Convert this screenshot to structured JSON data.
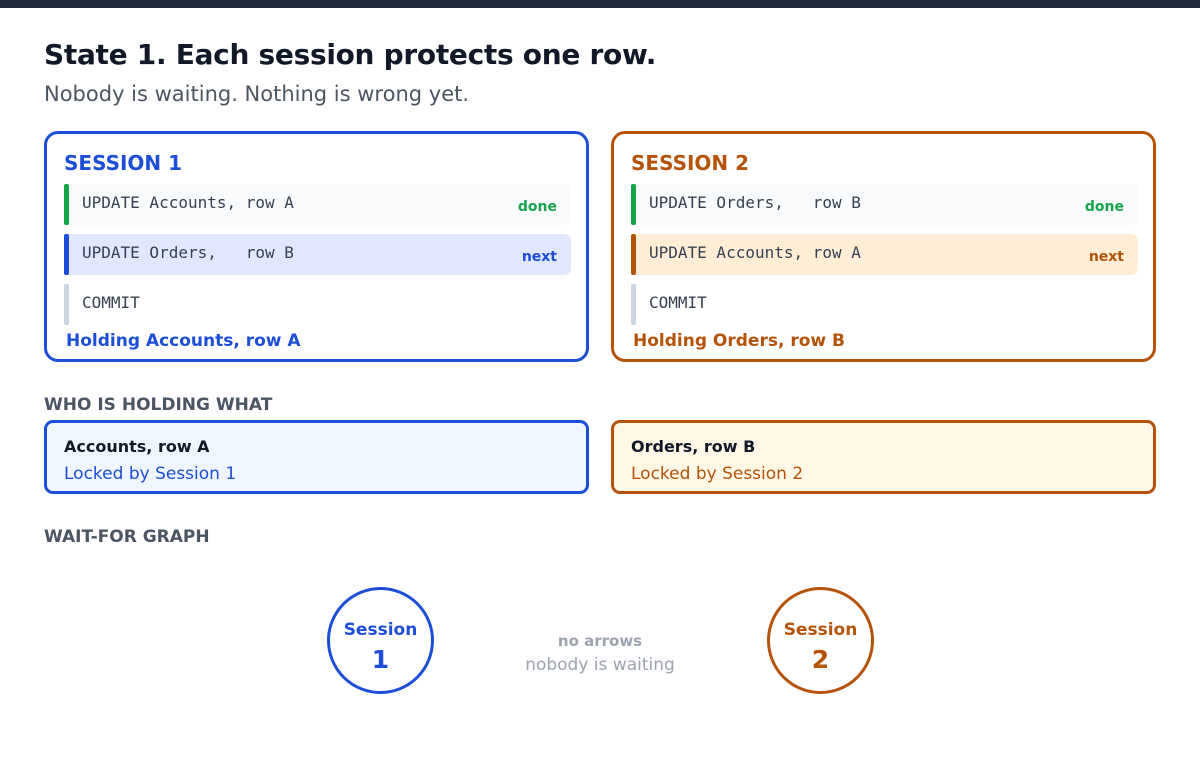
{
  "header": {
    "title": "State 1. Each session protects one row.",
    "subtitle": "Nobody is waiting. Nothing is wrong yet."
  },
  "sessions": [
    {
      "title": "SESSION 1",
      "statements": [
        {
          "sql": "UPDATE Accounts, row A",
          "status": "done"
        },
        {
          "sql": "UPDATE Orders,   row B",
          "status": "next"
        },
        {
          "sql": "COMMIT",
          "status": ""
        }
      ],
      "holding": "Holding Accounts, row A"
    },
    {
      "title": "SESSION 2",
      "statements": [
        {
          "sql": "UPDATE Orders,   row B",
          "status": "done"
        },
        {
          "sql": "UPDATE Accounts, row A",
          "status": "next"
        },
        {
          "sql": "COMMIT",
          "status": ""
        }
      ],
      "holding": "Holding Orders, row B"
    }
  ],
  "holding_section": {
    "label": "WHO IS HOLDING WHAT",
    "locks": [
      {
        "row": "Accounts, row A",
        "locked_by": "Locked by Session 1"
      },
      {
        "row": "Orders, row B",
        "locked_by": "Locked by Session 2"
      }
    ]
  },
  "graph": {
    "label": "WAIT-FOR GRAPH",
    "nodes": [
      {
        "label": "Session",
        "number": "1"
      },
      {
        "label": "Session",
        "number": "2"
      }
    ],
    "note_main": "no arrows",
    "note_sub": "nobody is waiting"
  },
  "colors": {
    "session1": "#1d4ed8",
    "session2": "#b45309",
    "done": "#16a34a",
    "dark_bar": "#1e293b"
  }
}
